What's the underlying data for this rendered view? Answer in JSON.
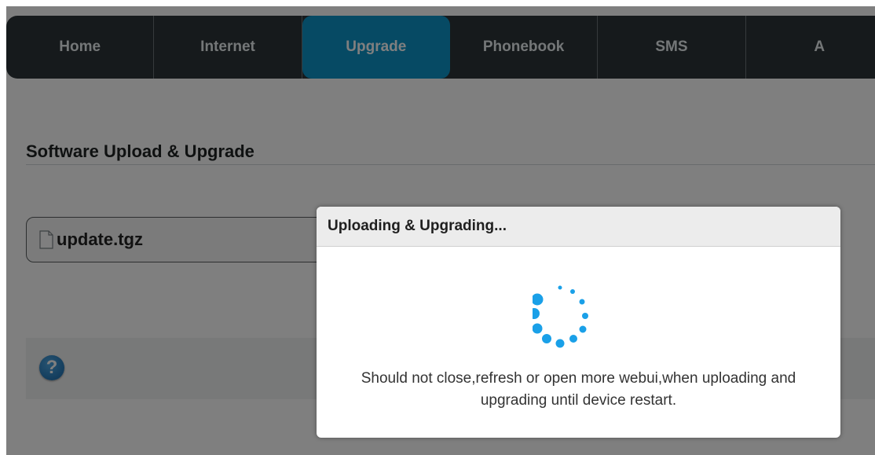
{
  "nav": {
    "tabs": [
      {
        "label": "Home",
        "active": false
      },
      {
        "label": "Internet",
        "active": false
      },
      {
        "label": "Upgrade",
        "active": true
      },
      {
        "label": "Phonebook",
        "active": false
      },
      {
        "label": "SMS",
        "active": false
      },
      {
        "label": "A",
        "active": false
      }
    ]
  },
  "page": {
    "title": "Software Upload & Upgrade",
    "file_name": "update.tgz"
  },
  "modal": {
    "title": "Uploading & Upgrading...",
    "message_line1": "Should not close,refresh or open more webui,when uploading and",
    "message_line2": "upgrading until device restart."
  },
  "colors": {
    "nav_bg": "#2d3538",
    "active_tab": "#0d95c9",
    "spinner": "#1aa0e8"
  },
  "icons": [
    "file-icon",
    "help-icon",
    "spinner-icon"
  ]
}
